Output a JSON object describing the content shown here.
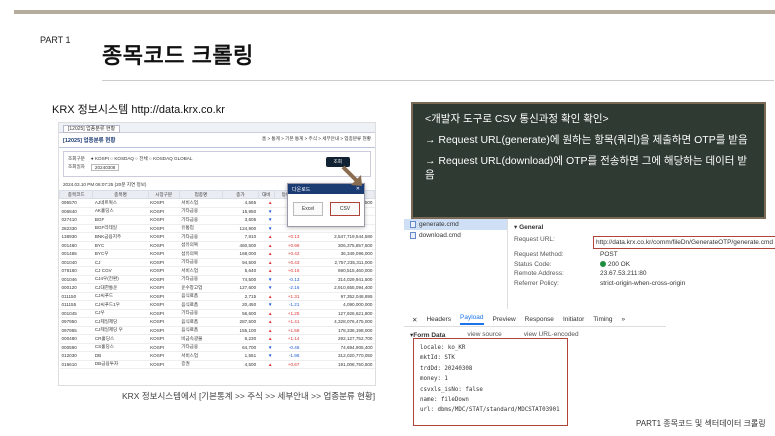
{
  "slide": {
    "part": "PART 1",
    "title": "종목코드 크롤링",
    "footer": "PART1 종목코드 및 섹터데이터 크롤링"
  },
  "krx": {
    "label": "KRX 정보시스템  http://data.krx.co.kr",
    "caption": "KRX 정보시스템에서 [기본통계 >> 주식 >> 세부안내 >> 업종분류 현황]",
    "tab": "[12025] 업종분류 현황",
    "page_title": "[12025] 업종분류 현황",
    "breadcrumb": "홈 > 통계 > 기본 통계 > 주식 > 세부안내 > 업종분류 현황",
    "market_label": "조회구분",
    "markets": "● KOSPI   ○ KOSDAQ   ○ 전체   ○ KOSDAQ GLOBAL",
    "date_label": "조회일자",
    "date_value": "20240308",
    "lookup_btn": "조회",
    "timestamp": "2024.03.10 PM 06:07:25 (20분 지연 정보)",
    "popup_title": "다운로드",
    "excel_btn": "Excel",
    "csv_btn": "CSV",
    "columns": [
      "종목코드",
      "종목명",
      "시장구분",
      "업종명",
      "종가",
      "대비",
      "등락률",
      "시가총액"
    ],
    "rows": [
      [
        "095570",
        "AJ네트웍스",
        "KOSPI",
        "서비스업",
        "4,565",
        "▲",
        "",
        "95,505,500"
      ],
      [
        "006840",
        "AK홀딩스",
        "KOSPI",
        "기타금융",
        "15,950",
        "▼",
        "",
        ""
      ],
      [
        "027410",
        "BGF",
        "KOSPI",
        "기타금융",
        "3,605",
        "▼",
        "",
        ""
      ],
      [
        "282330",
        "BGF리테일",
        "KOSPI",
        "유통업",
        "124,900",
        "▼",
        "",
        ""
      ],
      [
        "138930",
        "BNK금융지주",
        "KOSPI",
        "기타금융",
        "7,910",
        "▲",
        "+0.13",
        "2,547,719,544,580"
      ],
      [
        "001460",
        "BYC",
        "KOSPI",
        "섬유의복",
        "460,500",
        "▲",
        "+0.96",
        "306,375,857,500"
      ],
      [
        "001465",
        "BYC우",
        "KOSPI",
        "섬유의복",
        "168,000",
        "▲",
        "+0.42",
        "36,349,096,000"
      ],
      [
        "001040",
        "CJ",
        "KOSPI",
        "기타금융",
        "94,500",
        "▲",
        "+0.43",
        "2,757,235,311,000"
      ],
      [
        "079160",
        "CJ CGV",
        "KOSPI",
        "서비스업",
        "5,640",
        "▲",
        "+0.16",
        "690,515,460,000"
      ],
      [
        "001046",
        "CJ4우(전환)",
        "KOSPI",
        "기타금융",
        "74,500",
        "▼",
        "-0.13",
        "314,029,941,500"
      ],
      [
        "000120",
        "CJ대한통운",
        "KOSPI",
        "운수창고업",
        "127,600",
        "▼",
        "-2.16",
        "2,910,655,094,400"
      ],
      [
        "011150",
        "CJ씨푸드",
        "KOSPI",
        "음식료품",
        "2,715",
        "▲",
        "+1.31",
        "97,352,048,895"
      ],
      [
        "011155",
        "CJ씨푸드1우",
        "KOSPI",
        "음식료품",
        "20,450",
        "▼",
        "-1.21",
        "4,090,000,000"
      ],
      [
        "001045",
        "CJ우",
        "KOSPI",
        "기타금융",
        "56,600",
        "▲",
        "+1.25",
        "127,926,621,800"
      ],
      [
        "097950",
        "CJ제일제당",
        "KOSPI",
        "음식료품",
        "287,500",
        "▲",
        "+1.41",
        "4,328,076,475,000"
      ],
      [
        "097955",
        "CJ제일제당 우",
        "KOSPI",
        "음식료품",
        "155,100",
        "▲",
        "+1.58",
        "178,336,198,000"
      ],
      [
        "000480",
        "CR홀딩스",
        "KOSPI",
        "비금속광물",
        "6,230",
        "▲",
        "+1.14",
        "292,127,752,700"
      ],
      [
        "000590",
        "CS홀딩스",
        "KOSPI",
        "기타금융",
        "64,700",
        "▼",
        "-0.46",
        "74,694,905,400"
      ],
      [
        "012030",
        "DB",
        "KOSPI",
        "서비스업",
        "1,551",
        "▼",
        "-1.96",
        "312,020,770,050"
      ],
      [
        "016610",
        "DB금융투자",
        "KOSPI",
        "증권",
        "4,500",
        "▲",
        "+0.67",
        "191,008,750,500"
      ]
    ]
  },
  "blackboard": {
    "heading": "<개발자 도구로 CSV 통신과정 확인 확인>",
    "line1": "→ Request URL(generate)에 원하는 항목(쿼리)을 제출하면 OTP를 받음",
    "line2": "→ Request URL(download)에 OTP를 전송하면 그에 해당하는 데이터 받음"
  },
  "devtools": {
    "files": [
      "generate.cmd",
      "download.cmd"
    ],
    "general_header": "▾ General",
    "request_url_label": "Request URL:",
    "request_url": "http://data.krx.co.kr/comm/fileDn/GenerateOTP/generate.cmd",
    "method_label": "Request Method:",
    "method": "POST",
    "status_label": "Status Code:",
    "status": "200 OK",
    "remote_label": "Remote Address:",
    "remote": "23.67.53.211:80",
    "referrer_label": "Referrer Policy:",
    "referrer": "strict-origin-when-cross-origin",
    "tabs": [
      "✕",
      "Headers",
      "Payload",
      "Preview",
      "Response",
      "Initiator",
      "Timing",
      "»"
    ],
    "form_data": "▾Form Data",
    "view_source": "view source",
    "view_url": "view URL-encoded",
    "payload": [
      "locale: ko_KR",
      "mktId: STK",
      "trdDd: 20240308",
      "money: 1",
      "csvxls_isNo: false",
      "name: fileDown",
      "url: dbms/MDC/STAT/standard/MDCSTAT03901"
    ]
  },
  "colors": {
    "accent": "#1a73e8",
    "highlight": "#b0433a",
    "board": "#2f3a32",
    "navy": "#1b3b73"
  }
}
